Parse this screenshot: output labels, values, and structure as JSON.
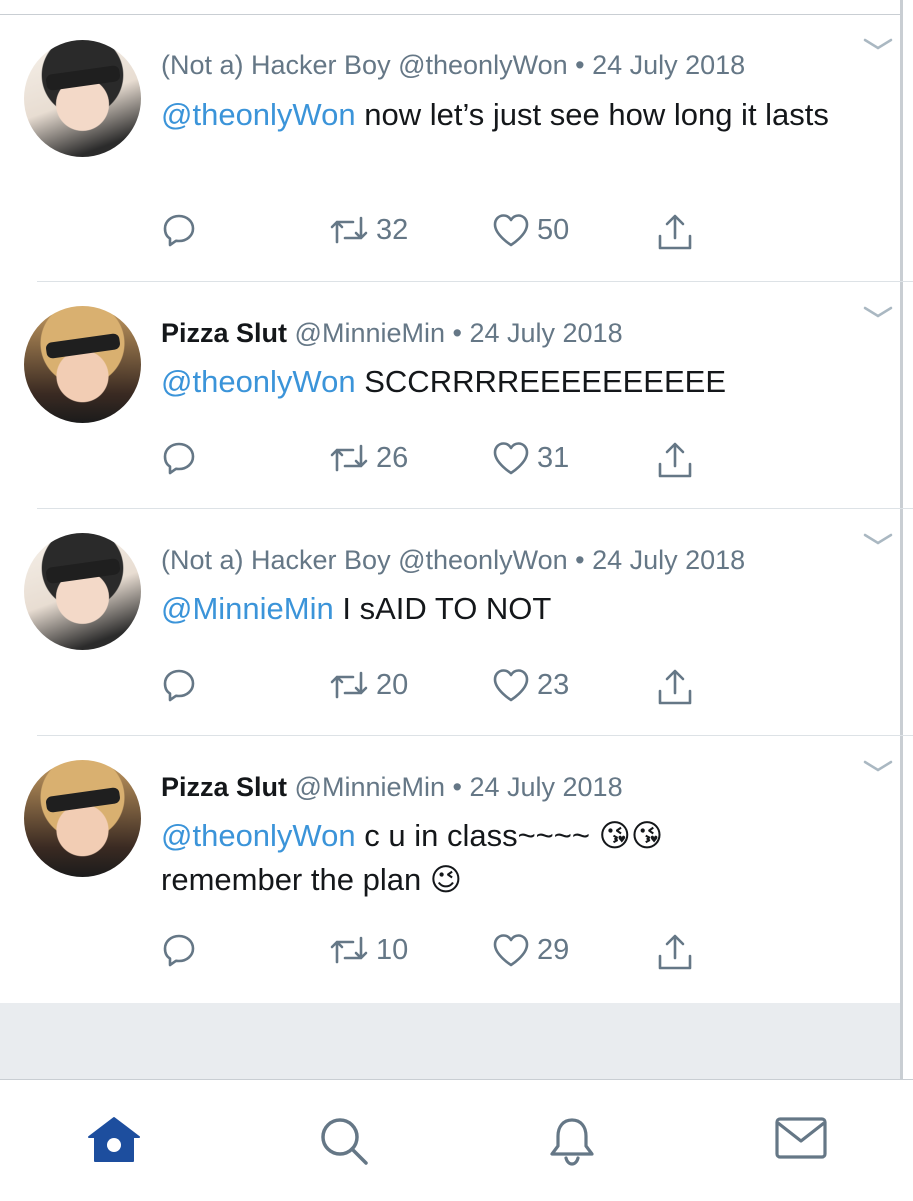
{
  "tweets": [
    {
      "display_name": "(Not a) Hacker Boy",
      "handle": "@theonlyWon",
      "date": "• 24 July 2018",
      "mention": "@theonlyWon",
      "text": " now let’s just see how long it lasts",
      "retweets": "32",
      "likes": "50",
      "avatar": "hacker-avatar"
    },
    {
      "display_name": "Pizza Slut",
      "handle": "@MinnieMin",
      "date": "• 24 July 2018",
      "mention": "@theonlyWon",
      "text": " SCCRRRREEEEEEEEEE",
      "retweets": "26",
      "likes": "31",
      "avatar": "pizza-avatar"
    },
    {
      "display_name": "(Not a) Hacker Boy",
      "handle": "@theonlyWon",
      "date": "• 24 July 2018",
      "mention": "@MinnieMin",
      "text": " I sAID TO NOT",
      "retweets": "20",
      "likes": "23",
      "avatar": "hacker-avatar"
    },
    {
      "display_name": "Pizza Slut",
      "handle": "@MinnieMin",
      "date": "• 24 July 2018",
      "mention": "@theonlyWon",
      "text": " c u in class~~~~ 😘😘 remember the plan 😉",
      "retweets": "10",
      "likes": "29",
      "avatar": "pizza-avatar"
    }
  ],
  "tabbar": {
    "items": [
      "home-icon",
      "search-icon",
      "notifications-icon",
      "messages-icon"
    ],
    "active": "home-icon"
  },
  "colors": {
    "accent": "#3b94d9",
    "active_tab": "#1d4e9e",
    "muted": "#657786"
  }
}
